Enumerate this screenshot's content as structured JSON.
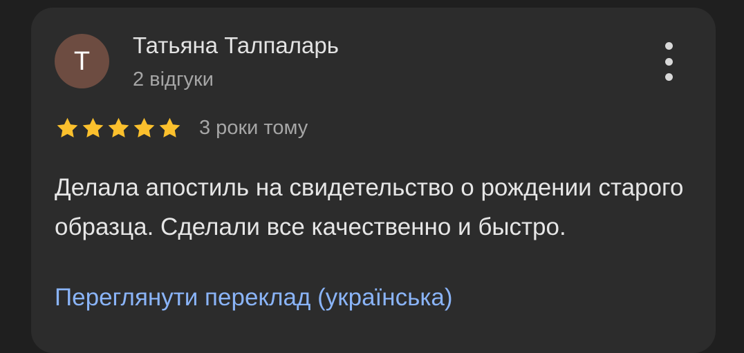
{
  "review": {
    "avatar_letter": "T",
    "avatar_color": "#6d4c41",
    "author_name": "Татьяна Талпаларь",
    "author_meta": "2 відгуки",
    "rating": 5,
    "rating_max": 5,
    "star_color": "#fbc02d",
    "date": "3 роки тому",
    "text": "Делала апостиль на свидетельство о рождении старого образца. Сделали все качественно и быстро.",
    "translate_link": "Переглянути переклад (українська)",
    "more_icon": "more-vertical-icon"
  },
  "colors": {
    "background": "#1f1f1f",
    "card": "#2c2c2c",
    "link": "#8ab4f8"
  }
}
